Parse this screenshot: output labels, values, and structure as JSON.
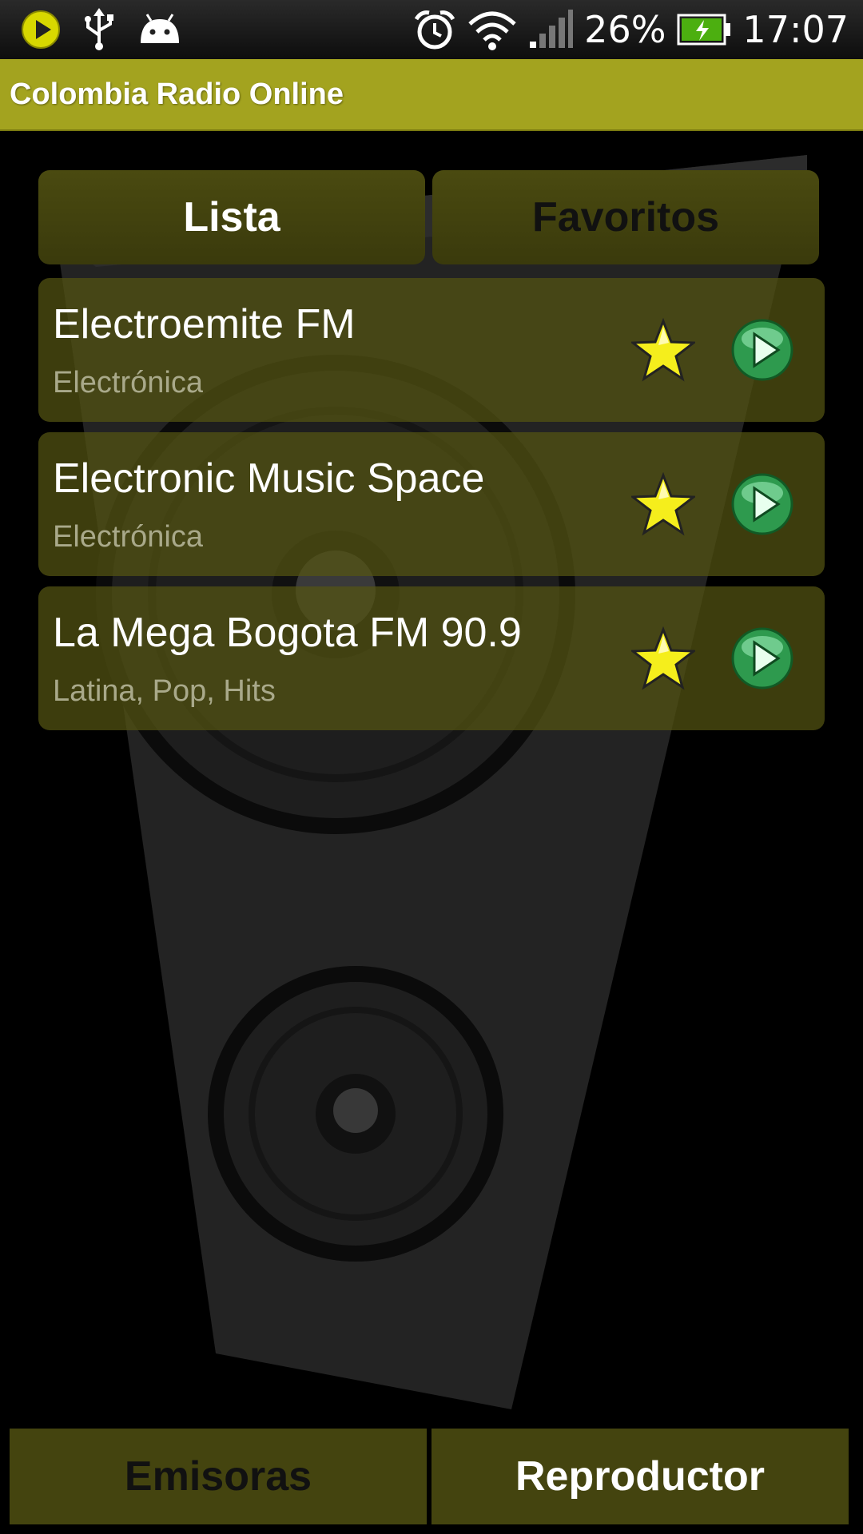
{
  "status_bar": {
    "icons": [
      "player-notification-icon",
      "usb-icon",
      "android-icon",
      "alarm-icon",
      "wifi-icon",
      "signal-icon",
      "battery-charging-icon"
    ],
    "battery_percent": "26%",
    "time": "17:07"
  },
  "app": {
    "title": "Colombia Radio Online",
    "accent_color": "#a3a31f"
  },
  "tabs": [
    {
      "label": "Lista",
      "active": true
    },
    {
      "label": "Favoritos",
      "active": false
    }
  ],
  "stations": [
    {
      "name": "Electroemite FM",
      "genre": "Electrónica"
    },
    {
      "name": "Electronic Music Space",
      "genre": "Electrónica"
    },
    {
      "name": "La Mega Bogota FM 90.9",
      "genre": "Latina, Pop, Hits"
    }
  ],
  "bottom_nav": [
    {
      "label": "Emisoras",
      "active": false
    },
    {
      "label": "Reproductor",
      "active": true
    }
  ]
}
